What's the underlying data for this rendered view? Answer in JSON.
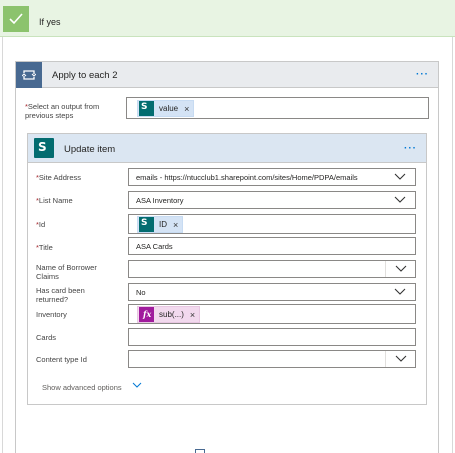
{
  "if_yes": {
    "label": "If yes"
  },
  "apply_each": {
    "title": "Apply to each 2",
    "more": "···",
    "select_label": "Select an output from previous steps",
    "select_token": {
      "label": "value",
      "remove": "×"
    }
  },
  "update_item": {
    "title": "Update item",
    "more": "···",
    "fields": {
      "site_address": {
        "label": "Site Address",
        "value": "emails - https://ntucclub1.sharepoint.com/sites/Home/PDPA/emails"
      },
      "list_name": {
        "label": "List Name",
        "value": "ASA Inventory"
      },
      "id": {
        "label": "Id",
        "token": "ID",
        "remove": "×"
      },
      "title": {
        "label": "Title",
        "value": "ASA Cards"
      },
      "name_of_borrower": {
        "label": "Name of Borrower Claims",
        "value": ""
      },
      "has_card_returned": {
        "label": "Has card been returned?",
        "value": "No"
      },
      "inventory": {
        "label": "Inventory",
        "token": "sub(...)",
        "remove": "×",
        "token_icon": "fx"
      },
      "cards": {
        "label": "Cards",
        "value": ""
      },
      "content_type_id": {
        "label": "Content type Id",
        "value": ""
      }
    },
    "required_mark": "*",
    "show_advanced": "Show advanced options"
  },
  "icons": {
    "check": "check-icon",
    "loop": "loop-icon",
    "sharepoint": "sharepoint-icon",
    "chevron": "chevron-down-icon"
  },
  "colors": {
    "accent_green": "#8cc36d",
    "loop_blue": "#486991",
    "sharepoint_teal": "#036c70",
    "expression_purple": "#a01b9d",
    "link_blue": "#0078d4"
  }
}
